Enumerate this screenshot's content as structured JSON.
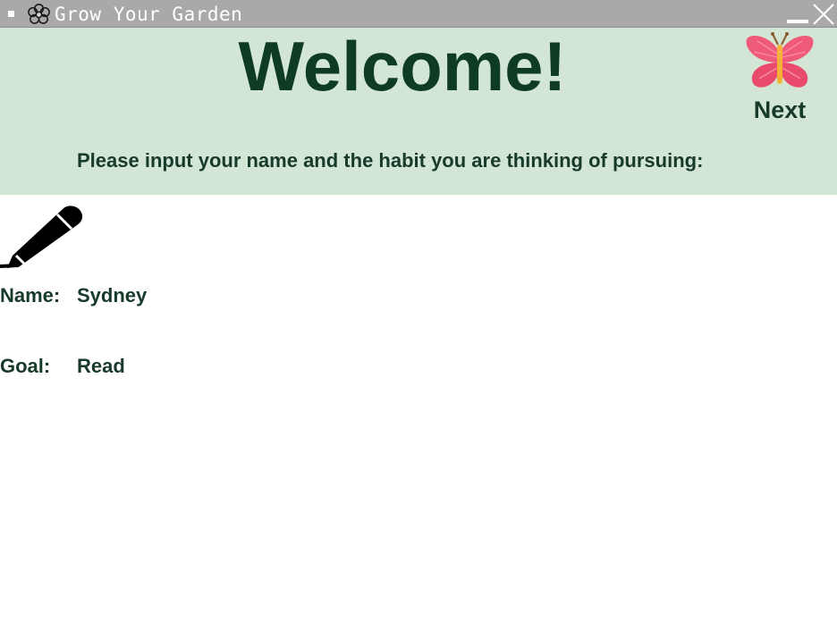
{
  "window": {
    "title": "Grow Your Garden",
    "icons": {
      "menu": "window-menu-icon",
      "app": "flower-icon",
      "minimize": "minimize-icon",
      "close": "close-icon"
    }
  },
  "header": {
    "heading": "Welcome!",
    "next_label": "Next",
    "next_icon": "butterfly-icon",
    "instruction": "Please input your name and the habit you are thinking of pursuing:",
    "background": "#d3e6d6"
  },
  "form": {
    "icon": "pencil-icon",
    "name_label": "Name:",
    "name_value": "Sydney",
    "goal_label": "Goal:",
    "goal_value": "Read"
  },
  "colors": {
    "text_dark_green": "#173a2a",
    "heading_green": "#0e3b24",
    "titlebar_gray": "#a9a9a9",
    "butterfly_pink": "#f05a7a"
  }
}
